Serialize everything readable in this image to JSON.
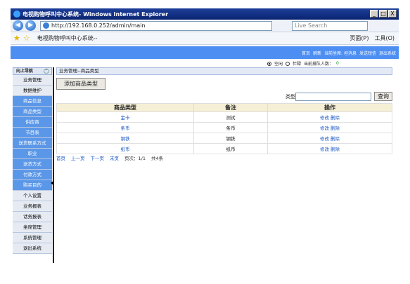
{
  "window": {
    "title": "电视购物呼叫中心系统-          Windows Internet Explorer",
    "min": "_",
    "max": "□",
    "close": "X"
  },
  "address": {
    "url": "http://192.168.0.252/admin/main",
    "search_placeholder": "Live Search"
  },
  "tabbar": {
    "tab_title": "电视购物呼叫中心系统--",
    "page_menu": "页面(P)",
    "tools_menu": "工具(O)"
  },
  "topnav": [
    "首页",
    "刷新",
    "当前坐席: 坦消息",
    "发送短信",
    "退出系统"
  ],
  "status": {
    "opt_idle": "空闲",
    "opt_busy": "忙碌",
    "queue_label": "当前排队人数：",
    "queue_count": "0"
  },
  "sidebar": {
    "header": "向上导航",
    "items": [
      {
        "label": "业务管理",
        "style": "gray"
      },
      {
        "label": "数据维护",
        "style": "gray"
      },
      {
        "label": "商品信息",
        "style": "blue"
      },
      {
        "label": "商品类型",
        "style": "blue"
      },
      {
        "label": "供应商",
        "style": "blue"
      },
      {
        "label": "节目表",
        "style": "blue"
      },
      {
        "label": "送货联系方式",
        "style": "blue"
      },
      {
        "label": "职业",
        "style": "blue"
      },
      {
        "label": "送货方式",
        "style": "blue"
      },
      {
        "label": "付款方式",
        "style": "blue"
      },
      {
        "label": "购买目的",
        "style": "blue"
      },
      {
        "label": "个人设置",
        "style": "gray"
      },
      {
        "label": "业务报表",
        "style": "gray"
      },
      {
        "label": "话务报表",
        "style": "gray"
      },
      {
        "label": "坐席管理",
        "style": "gray"
      },
      {
        "label": "系统管理",
        "style": "gray"
      },
      {
        "label": "退出系统",
        "style": "gray"
      }
    ]
  },
  "main": {
    "breadcrumb": "业务管理--商品类型",
    "add_button": "添加商品类型",
    "filter_label": "类型",
    "query_button": "查询",
    "columns": [
      "商品类型",
      "备注",
      "操作"
    ],
    "rows": [
      {
        "type": "金卡",
        "note": "测试",
        "edit": "修改",
        "del": "删除"
      },
      {
        "type": "条币",
        "note": "条币",
        "edit": "修改",
        "del": "删除"
      },
      {
        "type": "钢铁",
        "note": "钢铁",
        "edit": "修改",
        "del": "删除"
      },
      {
        "type": "纸币",
        "note": "纸币",
        "edit": "修改",
        "del": "删除"
      }
    ],
    "pager": {
      "first": "首页",
      "prev": "上一页",
      "next": "下一页",
      "last": "末页",
      "page_info": "页次：1/1",
      "total": "共4条"
    }
  }
}
